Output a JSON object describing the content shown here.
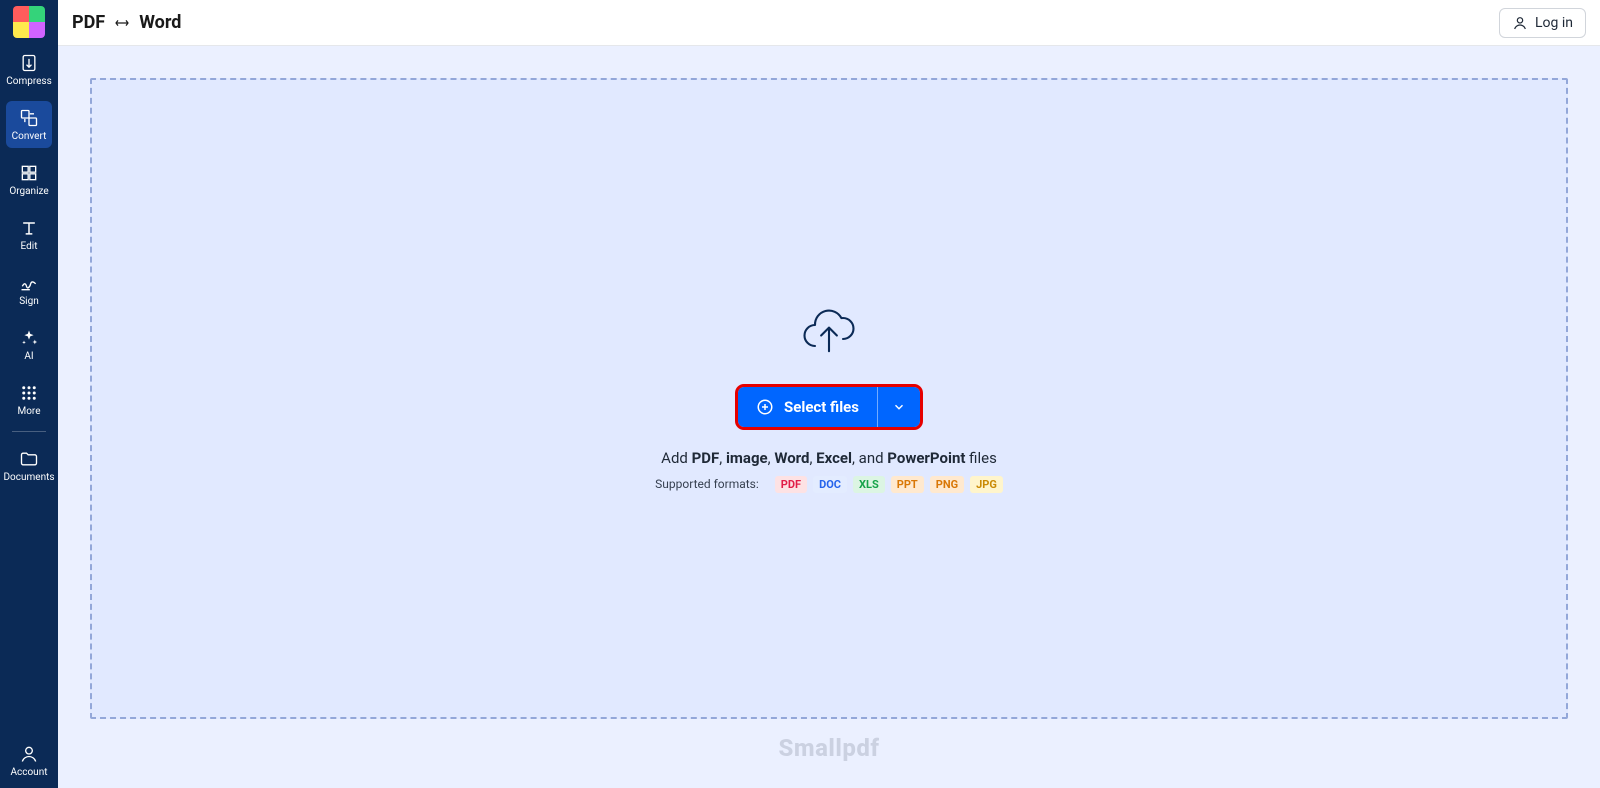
{
  "header": {
    "title_left": "PDF",
    "title_right": "Word",
    "login_label": "Log in"
  },
  "sidebar": {
    "items": [
      {
        "id": "compress",
        "label": "Compress"
      },
      {
        "id": "convert",
        "label": "Convert",
        "active": true
      },
      {
        "id": "organize",
        "label": "Organize"
      },
      {
        "id": "edit",
        "label": "Edit"
      },
      {
        "id": "sign",
        "label": "Sign"
      },
      {
        "id": "ai",
        "label": "AI"
      },
      {
        "id": "more",
        "label": "More"
      }
    ],
    "documents_label": "Documents",
    "account_label": "Account"
  },
  "dropzone": {
    "select_label": "Select files",
    "add_prefix": "Add ",
    "add_parts": [
      "PDF",
      "image",
      "Word",
      "Excel",
      "PowerPoint"
    ],
    "add_suffix": " files",
    "supported_label": "Supported formats:",
    "formats": [
      {
        "tag": "PDF",
        "fg": "#e11d48",
        "bg": "#fde2e4"
      },
      {
        "tag": "DOC",
        "fg": "#2563eb",
        "bg": "#e3ecff"
      },
      {
        "tag": "XLS",
        "fg": "#16a34a",
        "bg": "#dcf5e3"
      },
      {
        "tag": "PPT",
        "fg": "#d97706",
        "bg": "#ffe9cf"
      },
      {
        "tag": "PNG",
        "fg": "#d97706",
        "bg": "#ffe9cf"
      },
      {
        "tag": "JPG",
        "fg": "#ca8a04",
        "bg": "#fff5cc"
      }
    ]
  },
  "brand": "Smallpdf"
}
